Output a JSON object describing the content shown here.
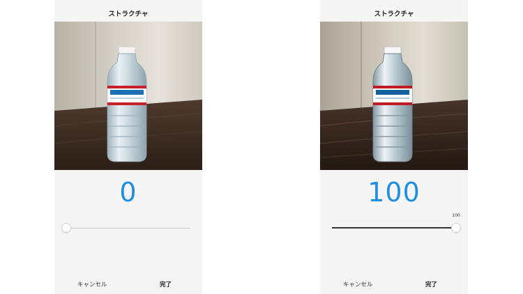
{
  "screens": [
    {
      "title": "ストラクチャ",
      "value": "0",
      "slider_level": 0,
      "slider_tip": "",
      "cancel_label": "キャンセル",
      "done_label": "完了"
    },
    {
      "title": "ストラクチャ",
      "value": "100",
      "slider_level": 100,
      "slider_tip": "100",
      "cancel_label": "キャンセル",
      "done_label": "完了"
    }
  ],
  "colors": {
    "accent": "#1e8fe1",
    "panel_background": "#f5f5f5"
  },
  "icons": {
    "photo_subject": "water-bottle-photo"
  }
}
